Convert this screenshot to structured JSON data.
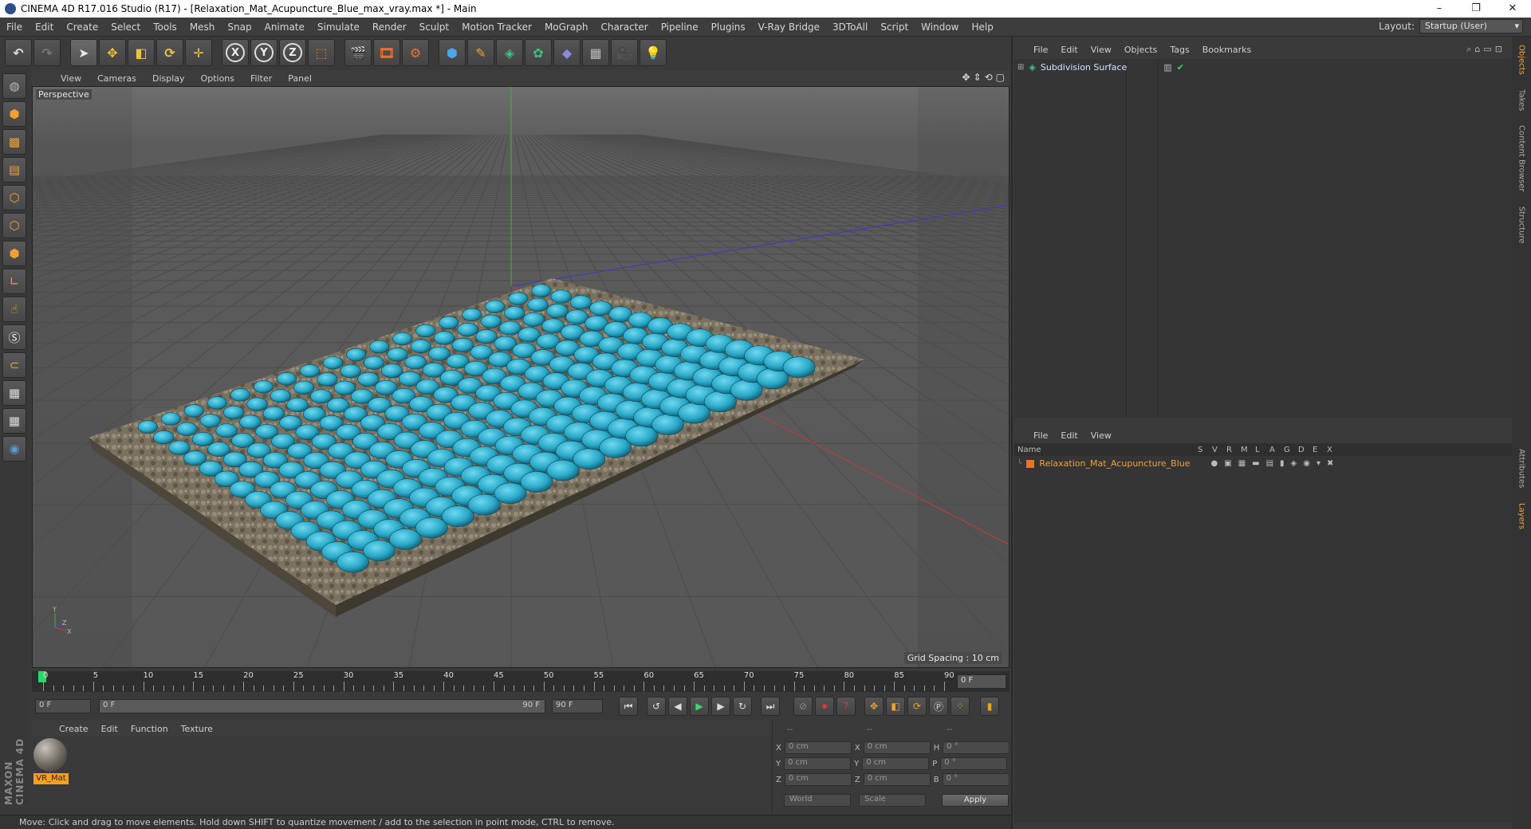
{
  "window": {
    "title": "CINEMA 4D R17.016 Studio (R17) - [Relaxation_Mat_Acupuncture_Blue_max_vray.max *] - Main",
    "minimize": "–",
    "maximize": "❐",
    "close": "✕"
  },
  "menu": [
    "File",
    "Edit",
    "Create",
    "Select",
    "Tools",
    "Mesh",
    "Snap",
    "Animate",
    "Simulate",
    "Render",
    "Sculpt",
    "Motion Tracker",
    "MoGraph",
    "Character",
    "Pipeline",
    "Plugins",
    "V-Ray Bridge",
    "3DToAll",
    "Script",
    "Window",
    "Help"
  ],
  "layout": {
    "label": "Layout:",
    "value": "Startup (User)"
  },
  "viewport": {
    "menu": [
      "View",
      "Cameras",
      "Display",
      "Options",
      "Filter",
      "Panel"
    ],
    "label": "Perspective",
    "grid_spacing": "Grid Spacing : 10 cm"
  },
  "timeline": {
    "ticks": [
      "0",
      "5",
      "10",
      "15",
      "20",
      "25",
      "30",
      "35",
      "40",
      "45",
      "50",
      "55",
      "60",
      "65",
      "70",
      "75",
      "80",
      "85",
      "90"
    ],
    "current_frame": "0 F",
    "start_field": "0 F",
    "slider_start": "0 F",
    "slider_end": "90 F",
    "end_field": "90 F"
  },
  "material_manager": {
    "menu": [
      "Create",
      "Edit",
      "Function",
      "Texture"
    ],
    "material_name": "VR_Mat"
  },
  "coordinates": {
    "headers": [
      "--",
      "--",
      "--"
    ],
    "rows": [
      {
        "a": "X",
        "v1": "0 cm",
        "b": "X",
        "v2": "0 cm",
        "c": "H",
        "v3": "0 °"
      },
      {
        "a": "Y",
        "v1": "0 cm",
        "b": "Y",
        "v2": "0 cm",
        "c": "P",
        "v3": "0 °"
      },
      {
        "a": "Z",
        "v1": "0 cm",
        "b": "Z",
        "v2": "0 cm",
        "c": "B",
        "v3": "0 °"
      }
    ],
    "world": "World",
    "scale": "Scale",
    "apply": "Apply"
  },
  "status": "Move: Click and drag to move elements. Hold down SHIFT to quantize movement / add to the selection in point mode, CTRL to remove.",
  "objects": {
    "menu": [
      "File",
      "Edit",
      "View",
      "Objects",
      "Tags",
      "Bookmarks"
    ],
    "item": "Subdivision Surface"
  },
  "layers": {
    "menu": [
      "File",
      "Edit",
      "View"
    ],
    "columns": [
      "Name",
      "S",
      "V",
      "R",
      "M",
      "L",
      "A",
      "G",
      "D",
      "E",
      "X"
    ],
    "layer_name": "Relaxation_Mat_Acupuncture_Blue",
    "layer_color": "#e5761d"
  },
  "side_tabs": [
    "Objects",
    "Takes",
    "Content Browser",
    "Structure",
    "Attributes",
    "Layers"
  ],
  "maxon": "MAXON CINEMA 4D",
  "colors": {
    "spike": "#29a9c8",
    "mat": "#6e6659",
    "accent": "#f5a020"
  }
}
